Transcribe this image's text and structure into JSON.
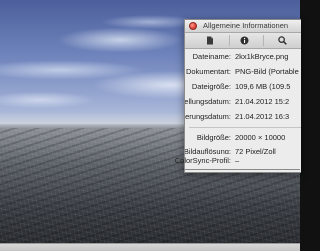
{
  "window": {
    "title": "Allgemeine Informationen"
  },
  "toolbar": {
    "buttons": [
      "general-info",
      "info",
      "zoom"
    ]
  },
  "file_info": [
    {
      "label": "Dateiname:",
      "value": "2kx1kBryce.png"
    },
    {
      "label": "Dokumentart:",
      "value": "PNG-Bild (Portable Network Graphics)"
    },
    {
      "label": "Dateigröße:",
      "value": "109,6 MB (109.5"
    },
    {
      "label": "Erstellungsdatum:",
      "value": "21.04.2012 15:2"
    },
    {
      "label": "Änderungsdatum:",
      "value": "21.04.2012 16:3"
    }
  ],
  "image_info": [
    {
      "label": "Bildgröße:",
      "value": "20000 × 10000"
    },
    {
      "label": "Bildauflösung:",
      "value": "72 Pixel/Zoll"
    },
    {
      "label": "Farbmodell:",
      "value": "RGB"
    },
    {
      "label": "ColorSync-Profil:",
      "value": "–"
    }
  ],
  "colors": {
    "close_button": "#e0443a",
    "panel_background": "#ececec"
  }
}
